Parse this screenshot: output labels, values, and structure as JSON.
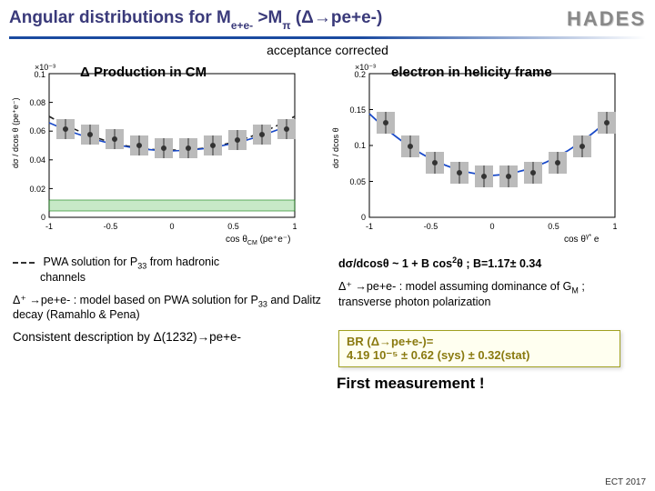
{
  "header": {
    "title_html": "Angular distributions for M<sub>e+e-</sub> >M<sub>π</sub>  (Δ→pe+e-)",
    "logo": "HADES"
  },
  "acceptance_label": "acceptance corrected",
  "left_chart": {
    "title": "Δ Production in CM",
    "xlabel": "cos θ_CM (pe⁺e⁻)",
    "ylabel": "dσ / dcos θ_CM (pe⁺e⁻)",
    "yscale_label": "×10⁻³"
  },
  "right_chart": {
    "title": "electron in helicity frame",
    "xlabel": "cos θ^γ* e",
    "ylabel": "dσ / dcos θ^γ* e",
    "yscale_label": "×10⁻³"
  },
  "legend": {
    "pwa_line1": "PWA solution for P",
    "pwa_sub": "33",
    "pwa_line1b": " from hadronic",
    "pwa_line2": "channels",
    "delta_model_l": "Δ⁺ →pe+e-  :  model based on PWA solution for P",
    "delta_model_l_sub": "33",
    "delta_model_l2": " and Dalitz decay (Ramahlo & Pena)",
    "formula_html": "dσ/dcosθ ~ 1 + B cos²θ ; B=1.17± 0.34",
    "delta_model_r": "Δ⁺ →pe+e-  :  model assuming dominance of G",
    "delta_model_r_sub": "M",
    "delta_model_r2": " ; transverse photon polarization"
  },
  "bottom": {
    "consistent": "Consistent description by Δ(1232)→pe+e-",
    "br_line1": "BR (Δ→pe+e-)=",
    "br_line2": "4.19  10⁻⁵ ± 0.62 (sys) ± 0.32(stat)",
    "first": "First measurement !"
  },
  "footer": "ECT 2017",
  "chart_data": [
    {
      "type": "scatter",
      "title": "Δ Production in CM",
      "xlabel": "cos θ_CM (pe⁺e⁻)",
      "ylabel": "dσ / dcos θ_CM (pe⁺e⁻) [×10⁻³]",
      "xlim": [
        -1,
        1
      ],
      "ylim": [
        0,
        0.1
      ],
      "series": [
        {
          "name": "data",
          "x": [
            -0.9,
            -0.7,
            -0.5,
            -0.3,
            -0.1,
            0.1,
            0.3,
            0.5,
            0.7,
            0.9
          ],
          "y": [
            0.062,
            0.058,
            0.055,
            0.05,
            0.048,
            0.048,
            0.05,
            0.054,
            0.058,
            0.062
          ],
          "yerr": [
            0.006,
            0.006,
            0.006,
            0.006,
            0.006,
            0.006,
            0.006,
            0.006,
            0.006,
            0.006
          ]
        },
        {
          "name": "PWA P33",
          "style": "dashed",
          "x": [
            -1,
            -0.5,
            0,
            0.5,
            1
          ],
          "y": [
            0.07,
            0.054,
            0.047,
            0.054,
            0.07
          ]
        },
        {
          "name": "Δ⁺→pe+e- model",
          "style": "solid-blue",
          "x": [
            -1,
            -0.5,
            0,
            0.5,
            1
          ],
          "y": [
            0.066,
            0.052,
            0.046,
            0.052,
            0.066
          ]
        },
        {
          "name": "background",
          "style": "green-hatch",
          "x": [
            -1,
            1
          ],
          "y": [
            0.009,
            0.009
          ]
        }
      ]
    },
    {
      "type": "scatter",
      "title": "electron in helicity frame",
      "xlabel": "cos θ^γ* e",
      "ylabel": "dσ / dcos θ^γ* e [×10⁻³]",
      "xlim": [
        -1,
        1
      ],
      "ylim": [
        0,
        0.2
      ],
      "series": [
        {
          "name": "data",
          "x": [
            -0.9,
            -0.7,
            -0.5,
            -0.3,
            -0.1,
            0.1,
            0.3,
            0.5,
            0.7,
            0.9
          ],
          "y": [
            0.13,
            0.098,
            0.075,
            0.062,
            0.057,
            0.057,
            0.062,
            0.075,
            0.098,
            0.13
          ],
          "yerr": [
            0.012,
            0.012,
            0.012,
            0.012,
            0.012,
            0.012,
            0.012,
            0.012,
            0.012,
            0.012
          ]
        },
        {
          "name": "1+Bcos²θ fit",
          "style": "solid-blue",
          "x": [
            -1,
            -0.5,
            0,
            0.5,
            1
          ],
          "y": [
            0.14,
            0.083,
            0.058,
            0.083,
            0.14
          ]
        }
      ]
    }
  ]
}
